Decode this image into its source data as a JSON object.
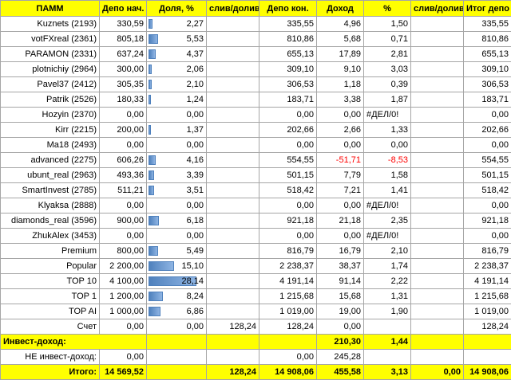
{
  "headers": [
    "ПАММ",
    "Депо нач.",
    "Доля, %",
    "слив/долив",
    "Депо кон.",
    "Доход",
    "%",
    "слив/долив",
    "Итог депо"
  ],
  "rows": [
    {
      "name": "Kuznets (2193)",
      "depo_start": "330,59",
      "share": "2,27",
      "share_frac": 0.0227,
      "sliv": "",
      "depo_end": "335,55",
      "income": "4,96",
      "pct": "1,50",
      "sliv2": "",
      "total": "335,55"
    },
    {
      "name": "votFXreal (2361)",
      "depo_start": "805,18",
      "share": "5,53",
      "share_frac": 0.0553,
      "sliv": "",
      "depo_end": "810,86",
      "income": "5,68",
      "pct": "0,71",
      "sliv2": "",
      "total": "810,86"
    },
    {
      "name": "PARAMON (2331)",
      "depo_start": "637,24",
      "share": "4,37",
      "share_frac": 0.0437,
      "sliv": "",
      "depo_end": "655,13",
      "income": "17,89",
      "pct": "2,81",
      "sliv2": "",
      "total": "655,13"
    },
    {
      "name": "plotnichiy (2964)",
      "depo_start": "300,00",
      "share": "2,06",
      "share_frac": 0.0206,
      "sliv": "",
      "depo_end": "309,10",
      "income": "9,10",
      "pct": "3,03",
      "sliv2": "",
      "total": "309,10"
    },
    {
      "name": "Pavel37 (2412)",
      "depo_start": "305,35",
      "share": "2,10",
      "share_frac": 0.021,
      "sliv": "",
      "depo_end": "306,53",
      "income": "1,18",
      "pct": "0,39",
      "sliv2": "",
      "total": "306,53"
    },
    {
      "name": "Patrik (2526)",
      "depo_start": "180,33",
      "share": "1,24",
      "share_frac": 0.0124,
      "sliv": "",
      "depo_end": "183,71",
      "income": "3,38",
      "pct": "1,87",
      "sliv2": "",
      "total": "183,71"
    },
    {
      "name": "Hozyin (2370)",
      "depo_start": "0,00",
      "share": "0,00",
      "share_frac": 0,
      "sliv": "",
      "depo_end": "0,00",
      "income": "0,00",
      "pct": "#ДЕЛ/0!",
      "sliv2": "",
      "total": "0,00",
      "err": true
    },
    {
      "name": "Kirr (2215)",
      "depo_start": "200,00",
      "share": "1,37",
      "share_frac": 0.0137,
      "sliv": "",
      "depo_end": "202,66",
      "income": "2,66",
      "pct": "1,33",
      "sliv2": "",
      "total": "202,66"
    },
    {
      "name": "Ma18 (2493)",
      "depo_start": "0,00",
      "share": "0,00",
      "share_frac": 0,
      "sliv": "",
      "depo_end": "0,00",
      "income": "0,00",
      "pct": "0,00",
      "sliv2": "",
      "total": "0,00"
    },
    {
      "name": "advanced (2275)",
      "depo_start": "606,26",
      "share": "4,16",
      "share_frac": 0.0416,
      "sliv": "",
      "depo_end": "554,55",
      "income": "-51,71",
      "pct": "-8,53",
      "sliv2": "",
      "total": "554,55",
      "neg": true
    },
    {
      "name": "ubunt_real (2963)",
      "depo_start": "493,36",
      "share": "3,39",
      "share_frac": 0.0339,
      "sliv": "",
      "depo_end": "501,15",
      "income": "7,79",
      "pct": "1,58",
      "sliv2": "",
      "total": "501,15"
    },
    {
      "name": "SmartInvest (2785)",
      "depo_start": "511,21",
      "share": "3,51",
      "share_frac": 0.0351,
      "sliv": "",
      "depo_end": "518,42",
      "income": "7,21",
      "pct": "1,41",
      "sliv2": "",
      "total": "518,42"
    },
    {
      "name": "Klyaksa (2888)",
      "depo_start": "0,00",
      "share": "0,00",
      "share_frac": 0,
      "sliv": "",
      "depo_end": "0,00",
      "income": "0,00",
      "pct": "#ДЕЛ/0!",
      "sliv2": "",
      "total": "0,00",
      "err": true
    },
    {
      "name": "diamonds_real (3596)",
      "depo_start": "900,00",
      "share": "6,18",
      "share_frac": 0.0618,
      "sliv": "",
      "depo_end": "921,18",
      "income": "21,18",
      "pct": "2,35",
      "sliv2": "",
      "total": "921,18"
    },
    {
      "name": "ZhukAlex (3453)",
      "depo_start": "0,00",
      "share": "0,00",
      "share_frac": 0,
      "sliv": "",
      "depo_end": "0,00",
      "income": "0,00",
      "pct": "#ДЕЛ/0!",
      "sliv2": "",
      "total": "0,00",
      "err": true
    },
    {
      "name": "Premium",
      "depo_start": "800,00",
      "share": "5,49",
      "share_frac": 0.0549,
      "sliv": "",
      "depo_end": "816,79",
      "income": "16,79",
      "pct": "2,10",
      "sliv2": "",
      "total": "816,79"
    },
    {
      "name": "Popular",
      "depo_start": "2 200,00",
      "share": "15,10",
      "share_frac": 0.151,
      "sliv": "",
      "depo_end": "2 238,37",
      "income": "38,37",
      "pct": "1,74",
      "sliv2": "",
      "total": "2 238,37"
    },
    {
      "name": "TOP 10",
      "depo_start": "4 100,00",
      "share": "28,14",
      "share_frac": 0.2814,
      "sliv": "",
      "depo_end": "4 191,14",
      "income": "91,14",
      "pct": "2,22",
      "sliv2": "",
      "total": "4 191,14"
    },
    {
      "name": "TOP 1",
      "depo_start": "1 200,00",
      "share": "8,24",
      "share_frac": 0.0824,
      "sliv": "",
      "depo_end": "1 215,68",
      "income": "15,68",
      "pct": "1,31",
      "sliv2": "",
      "total": "1 215,68"
    },
    {
      "name": "TOP AI",
      "depo_start": "1 000,00",
      "share": "6,86",
      "share_frac": 0.0686,
      "sliv": "",
      "depo_end": "1 019,00",
      "income": "19,00",
      "pct": "1,90",
      "sliv2": "",
      "total": "1 019,00"
    },
    {
      "name": "Счет",
      "depo_start": "0,00",
      "share": "0,00",
      "share_frac": 0,
      "sliv": "128,24",
      "depo_end": "128,24",
      "income": "0,00",
      "pct": "",
      "sliv2": "",
      "total": "128,24"
    }
  ],
  "invest": {
    "label": "Инвест-доход:",
    "income": "210,30",
    "pct": "1,44"
  },
  "non_invest": {
    "label": "НЕ инвест-доход:",
    "depo_start": "0,00",
    "depo_end": "0,00",
    "income": "245,28"
  },
  "totals": {
    "label": "Итого:",
    "depo_start": "14 569,52",
    "sliv": "128,24",
    "depo_end": "14 908,06",
    "income": "455,58",
    "pct": "3,13",
    "sliv2": "0,00",
    "total": "14 908,06"
  },
  "colors": {
    "header_bg": "#ffff00",
    "bar": "#4f81bd",
    "negative": "#ff0000",
    "grid": "#a6a6a6",
    "comment_marker": "#2e8b57"
  }
}
